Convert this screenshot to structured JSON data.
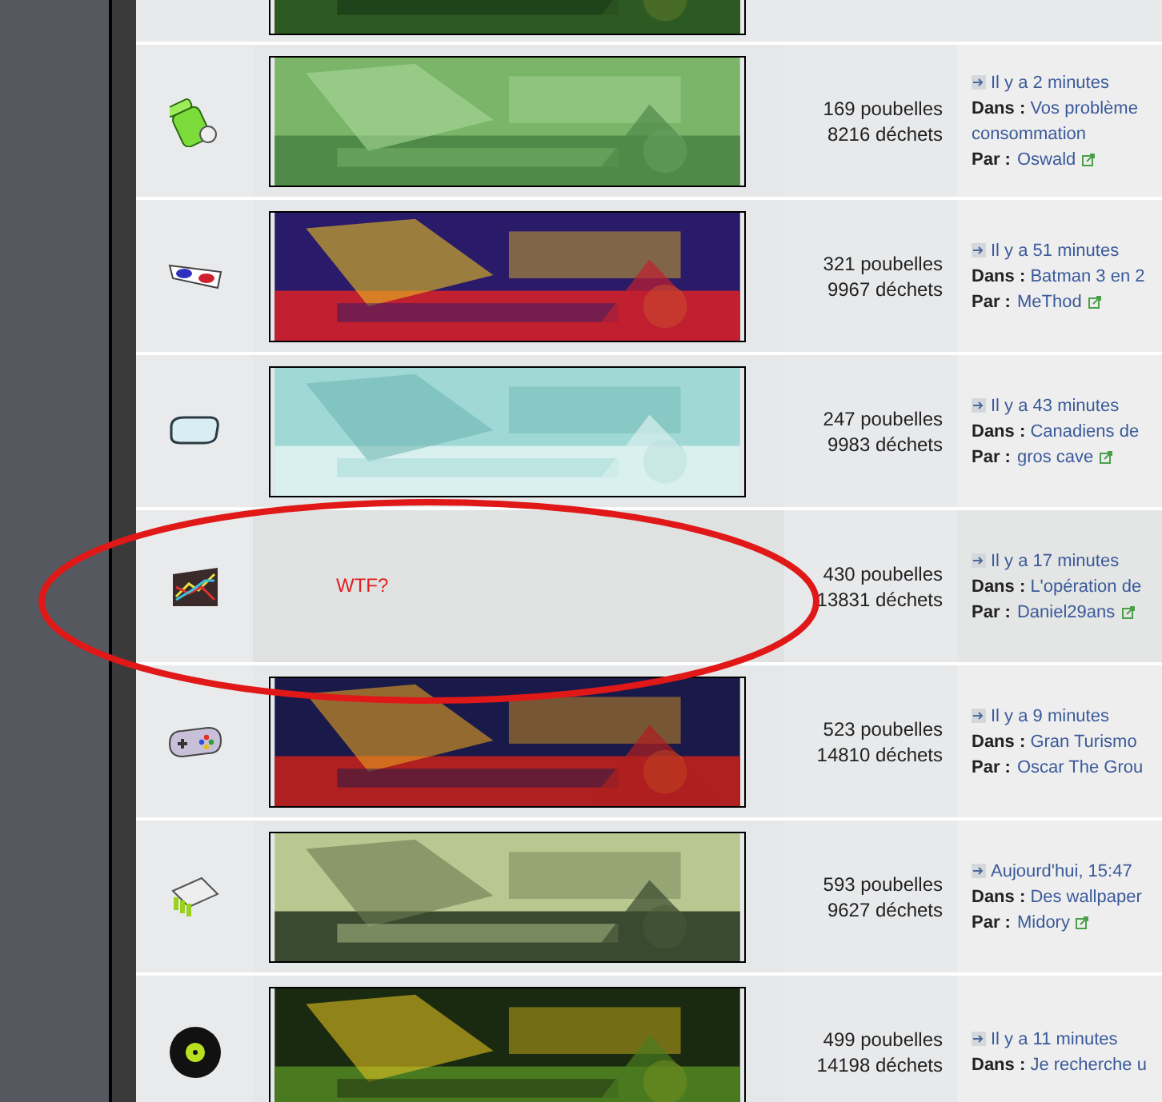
{
  "forums": [
    {
      "kind": "banner",
      "stats": [
        "169 poubelles",
        "8216 déchets"
      ],
      "last_post": {
        "time": "Il y a 2 minutes",
        "in_label": "Dans :",
        "topic": "Vos problème",
        "topic_more": "consommation",
        "by_label": "Par :",
        "author": "Oswald",
        "link_icon": true
      }
    },
    {
      "kind": "banner",
      "stats": [
        "321 poubelles",
        "9967 déchets"
      ],
      "last_post": {
        "time": "Il y a 51 minutes",
        "in_label": "Dans :",
        "topic": "Batman 3 en 2",
        "by_label": "Par :",
        "author": "MeThod",
        "link_icon": true
      }
    },
    {
      "kind": "banner",
      "stats": [
        "247 poubelles",
        "9983 déchets"
      ],
      "last_post": {
        "time": "Il y a 43 minutes",
        "in_label": "Dans :",
        "topic": "Canadiens de",
        "by_label": "Par :",
        "author": "gros cave",
        "link_icon": true
      }
    },
    {
      "kind": "text",
      "title": "WTF?",
      "stats": [
        "430 poubelles",
        "13831 déchets"
      ],
      "last_post": {
        "time": "Il y a 17 minutes",
        "in_label": "Dans :",
        "topic": "L'opération de",
        "by_label": "Par :",
        "author": "Daniel29ans",
        "link_icon": true
      }
    },
    {
      "kind": "banner",
      "stats": [
        "523 poubelles",
        "14810 déchets"
      ],
      "last_post": {
        "time": "Il y a 9 minutes",
        "in_label": "Dans :",
        "topic": "Gran Turismo",
        "by_label": "Par :",
        "author": "Oscar The Grou",
        "link_icon": false
      }
    },
    {
      "kind": "banner",
      "stats": [
        "593 poubelles",
        "9627 déchets"
      ],
      "last_post": {
        "time": "Aujourd'hui, 15:47",
        "in_label": "Dans :",
        "topic": "Des wallpaper",
        "by_label": "Par :",
        "author": "Midory",
        "link_icon": true
      }
    },
    {
      "kind": "banner",
      "stats": [
        "499 poubelles",
        "14198 déchets"
      ],
      "last_post": {
        "time": "Il y a 11 minutes",
        "in_label": "Dans :",
        "topic": "Je recherche u"
      }
    }
  ]
}
